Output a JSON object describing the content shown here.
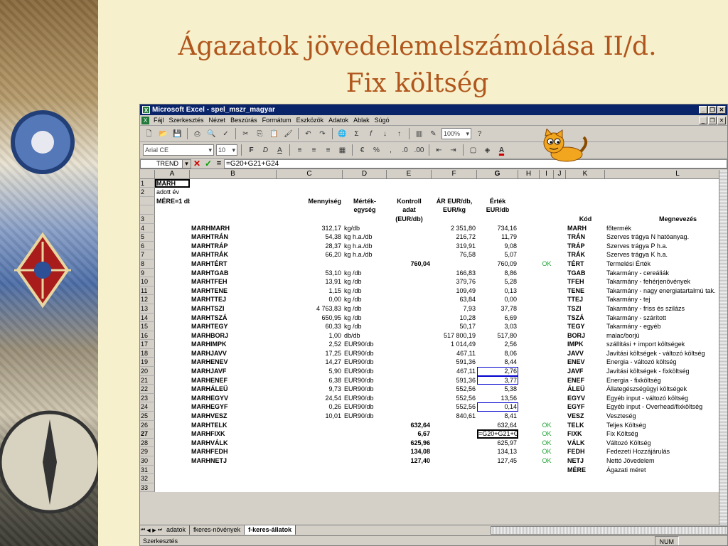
{
  "slide": {
    "title_line1": "Ágazatok jövedelemelszámolása II/d.",
    "title_line2": "Fix költség"
  },
  "excel": {
    "window_title": "Microsoft Excel - spel_mszr_magyar",
    "menu": [
      "Fájl",
      "Szerkesztés",
      "Nézet",
      "Beszúrás",
      "Formátum",
      "Eszközök",
      "Adatok",
      "Ablak",
      "Súgó"
    ],
    "font_name": "Arial CE",
    "font_size": "10",
    "zoom": "100%",
    "name_box": "TREND",
    "formula": "=G20+G21+G24",
    "columns": [
      "A",
      "B",
      "C",
      "D",
      "E",
      "F",
      "G",
      "H",
      "I",
      "J",
      "K",
      "L"
    ],
    "rows": [
      {
        "n": "1",
        "a": "MARH"
      },
      {
        "n": "2",
        "a": "adott év"
      },
      {
        "n": "",
        "a": "MÉRE=1 db",
        "c": "Mennyiség",
        "d": "Mérték-",
        "e": "Kontroll",
        "f": "ÁR EUR/db,",
        "g": "Érték"
      },
      {
        "n": "",
        "d": "egység",
        "e": "adat",
        "f": "EUR/kg",
        "g": "EUR/db"
      },
      {
        "n": "3",
        "e": "(EUR/db)",
        "k": "Kód",
        "l": "Megnevezés"
      },
      {
        "n": "4",
        "b": "MARHMARH",
        "c": "312,17",
        "d": "kg/db",
        "f": "2 351,80",
        "g": "734,16",
        "k": "MARH",
        "l": "főtermék"
      },
      {
        "n": "5",
        "b": "MARHTRÁN",
        "c": "54,38",
        "d": "kg h.a./db",
        "f": "216,72",
        "g": "11,79",
        "k": "TRÁN",
        "l": "Szerves trágya N hatóanyag."
      },
      {
        "n": "6",
        "b": "MARHTRÁP",
        "c": "28,37",
        "d": "kg h.a./db",
        "f": "319,91",
        "g": "9,08",
        "k": "TRÁP",
        "l": "Szerves trágya P h.a."
      },
      {
        "n": "7",
        "b": "MARHTRÁK",
        "c": "66,20",
        "d": "kg h.a./db",
        "f": "76,58",
        "g": "5,07",
        "k": "TRÁK",
        "l": "Szerves trágya K h.a."
      },
      {
        "n": "8",
        "b": "MARHTÉRT",
        "e": "760,04",
        "g": "760,09",
        "i": "OK",
        "k": "TÉRT",
        "l": "Termelési Érték"
      },
      {
        "n": "9",
        "b": "MARHTGAB",
        "c": "53,10",
        "d": "kg /db",
        "f": "166,83",
        "g": "8,86",
        "k": "TGAB",
        "l": "Takarmány - cereáliák"
      },
      {
        "n": "10",
        "b": "MARHTFEH",
        "c": "13,91",
        "d": "kg /db",
        "f": "379,76",
        "g": "5,28",
        "k": "TFEH",
        "l": "Takarmány - fehérjenövények"
      },
      {
        "n": "11",
        "b": "MARHTENE",
        "c": "1,15",
        "d": "kg /db",
        "f": "109,49",
        "g": "0,13",
        "k": "TENE",
        "l": "Takarmány - nagy energiatartalmú tak."
      },
      {
        "n": "12",
        "b": "MARHTTEJ",
        "c": "0,00",
        "d": "kg /db",
        "f": "63,84",
        "g": "0,00",
        "k": "TTEJ",
        "l": "Takarmány - tej"
      },
      {
        "n": "13",
        "b": "MARHTSZI",
        "c": "4 763,83",
        "d": "kg /db",
        "f": "7,93",
        "g": "37,78",
        "k": "TSZI",
        "l": "Takarmány - friss és szilázs"
      },
      {
        "n": "14",
        "b": "MARHTSZÁ",
        "c": "650,95",
        "d": "kg /db",
        "f": "10,28",
        "g": "6,69",
        "k": "TSZÁ",
        "l": "Takarmány - szárított"
      },
      {
        "n": "15",
        "b": "MARHTEGY",
        "c": "60,33",
        "d": "kg /db",
        "f": "50,17",
        "g": "3,03",
        "k": "TEGY",
        "l": "Takarmány - egyéb"
      },
      {
        "n": "16",
        "b": "MARHBORJ",
        "c": "1,00",
        "d": "db/db",
        "f": "517 800,19",
        "g": "517,80",
        "k": "BORJ",
        "l": "malac/borjú"
      },
      {
        "n": "17",
        "b": "MARHIMPK",
        "c": "2,52",
        "d": "EUR90/db",
        "f": "1 014,49",
        "g": "2,56",
        "k": "IMPK",
        "l": "szállítási + import költségek"
      },
      {
        "n": "18",
        "b": "MARHJAVV",
        "c": "17,25",
        "d": "EUR90/db",
        "f": "467,11",
        "g": "8,06",
        "k": "JAVV",
        "l": "Javítási költségek - változó költség"
      },
      {
        "n": "19",
        "b": "MARHENEV",
        "c": "14,27",
        "d": "EUR90/db",
        "f": "591,36",
        "g": "8,44",
        "k": "ENEV",
        "l": "Energia - változó költség"
      },
      {
        "n": "20",
        "b": "MARHJAVF",
        "c": "5,90",
        "d": "EUR90/db",
        "f": "467,11",
        "g": "2,76",
        "k": "JAVF",
        "l": "Javítási költségek - fixköltség"
      },
      {
        "n": "21",
        "b": "MARHENEF",
        "c": "6,38",
        "d": "EUR90/db",
        "f": "591,36",
        "g": "3,77",
        "k": "ENEF",
        "l": "Energia - fixköltség"
      },
      {
        "n": "22",
        "b": "MARHÁLEÜ",
        "c": "9,73",
        "d": "EUR90/db",
        "f": "552,56",
        "g": "5,38",
        "k": "ÁLEÜ",
        "l": "Állategészségügyi költségek"
      },
      {
        "n": "23",
        "b": "MARHEGYV",
        "c": "24,54",
        "d": "EUR90/db",
        "f": "552,56",
        "g": "13,56",
        "k": "EGYV",
        "l": "Egyéb input - változó költség"
      },
      {
        "n": "24",
        "b": "MARHEGYF",
        "c": "0,26",
        "d": "EUR90/db",
        "f": "552,56",
        "g": "0,14",
        "k": "EGYF",
        "l": "Egyéb input - Overhead/fixköltség"
      },
      {
        "n": "25",
        "b": "MARHVESZ",
        "c": "10,01",
        "d": "EUR90/db",
        "f": "840,61",
        "g": "8,41",
        "k": "VESZ",
        "l": "Veszteség"
      },
      {
        "n": "26",
        "b": "MARHTELK",
        "e": "632,64",
        "g": "632,64",
        "i": "OK",
        "k": "TELK",
        "l": "Teljes Költség"
      },
      {
        "n": "27",
        "b": "MARHFIXK",
        "e": "6,67",
        "g": "=G20+G21+G24",
        "i": "OK",
        "k": "FIXK",
        "l": "Fix Költség"
      },
      {
        "n": "28",
        "b": "MARHVÁLK",
        "e": "625,96",
        "g": "625,97",
        "i": "OK",
        "k": "VÁLK",
        "l": "Változó Költség"
      },
      {
        "n": "29",
        "b": "MARHFEDH",
        "e": "134,08",
        "g": "134,13",
        "i": "OK",
        "k": "FEDH",
        "l": "Fedezeti Hozzájárulás"
      },
      {
        "n": "30",
        "b": "MARHNETJ",
        "e": "127,40",
        "g": "127,45",
        "i": "OK",
        "k": "NETJ",
        "l": "Nettó Jövedelem"
      },
      {
        "n": "31",
        "k": "MÉRE",
        "l": "Ágazati méret"
      },
      {
        "n": "32"
      },
      {
        "n": "33"
      }
    ],
    "sheet_tabs": [
      "adatok",
      "fkeres-növények",
      "f-keres-állatok"
    ],
    "status_mode": "Szerkesztés",
    "status_num": "NUM"
  }
}
